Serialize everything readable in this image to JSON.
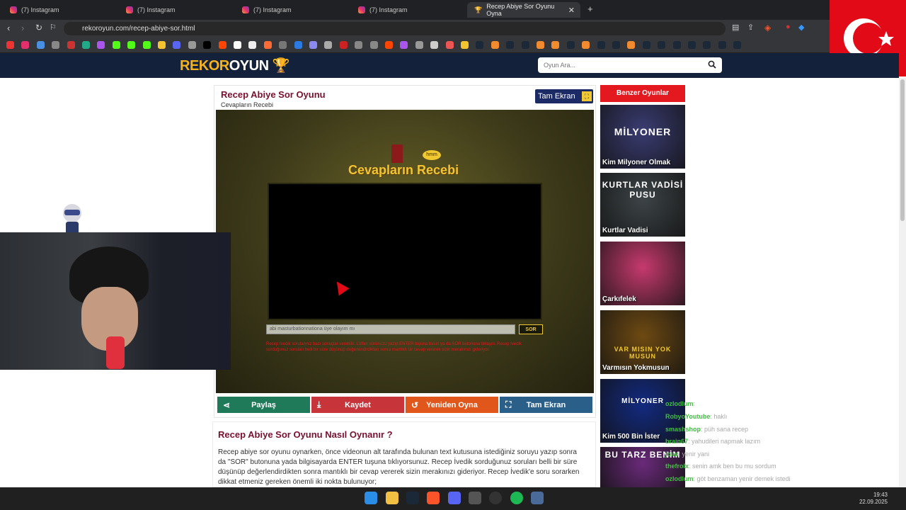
{
  "browser": {
    "tabs": [
      {
        "label": "(7) Instagram"
      },
      {
        "label": "(7) Instagram"
      },
      {
        "label": "(7) Instagram"
      },
      {
        "label": "(7) Instagram"
      },
      {
        "label": "Recep Abiye Sor Oyunu Oyna"
      }
    ],
    "url": "rekoroyun.com/recep-abiye-sor.html"
  },
  "site": {
    "logo_a": "REKOR",
    "logo_b": "OYUN",
    "search_placeholder": "Oyun Ara..."
  },
  "game": {
    "title": "Recep Abiye Sor Oyunu",
    "subtitle": "Cevapların Recebi",
    "fullscreen_label": "Tam Ekran",
    "inner_logo": "Cevapların Recebi",
    "hmm": "hmm",
    "question_value": "abi masturbationnationa üye olayım mı",
    "ask_label": "SOR",
    "warning_text": "Recep İvedik sorularınız bazı sonuçlar verebilir. Lütfen sorunuzu yazıp ENTER tuşuna basın ya da SOR butonuna tıklayın. Recep İvedik sorduğunuz soruları belli bir süre düşünüp değerlendirdikten sonra mantıklı bir cevap vererek sizin merakınızı gideriyor."
  },
  "actions": [
    {
      "label": "Paylaş",
      "color": "#1f7a5a"
    },
    {
      "label": "Kaydet",
      "color": "#c7343a"
    },
    {
      "label": "Yeniden Oyna",
      "color": "#e0561b"
    },
    {
      "label": "Tam Ekran",
      "color": "#2a5f8a"
    }
  ],
  "howto": {
    "title": "Recep Abiye Sor Oyunu Nasıl Oynanır ?",
    "text": "Recep abiye sor oyunu oynarken, önce videonun alt tarafında bulunan text kutusuna istediğiniz soruyu yazıp sonra da \"SOR\" butonuna yada bilgisayarda ENTER tuşuna tıklıyorsunuz. Recep İvedik sorduğunuz soruları belli bir süre düşünüp değerlendirdikten sonra mantıklı bir cevap vererek sizin merakınızı gideriyor. Recep İvedik'e soru sorarken dikkat etmeniz gereken önemli iki nokta bulunuyor;"
  },
  "sidebar": {
    "header": "Benzer Oyunlar",
    "cards": [
      {
        "label": "Kim Milyoner Olmak",
        "art": "MİLYONER",
        "bg": "#3a3c72"
      },
      {
        "label": "Kurtlar Vadisi",
        "art": "KURTLAR VADİSİ PUSU",
        "bg": "#3d4447"
      },
      {
        "label": "Çarkıfelek",
        "art": "",
        "bg": "#c63a6d"
      },
      {
        "label": "Varmısın Yokmusun",
        "art": "VAR MISIN YOK MUSUN",
        "bg": "#6e4a12"
      },
      {
        "label": "Kim 500 Bin İster",
        "art": "MİLYONER",
        "bg": "#132a80"
      },
      {
        "label": "",
        "art": "BU TARZ BENİM",
        "bg": "#6a2a7a"
      }
    ]
  },
  "chat": [
    {
      "user": "ozlodlum",
      "msg": ": "
    },
    {
      "user": "RobyoYoutube",
      "msg": ": haklı"
    },
    {
      "user": "smashshop",
      "msg": ": püh sana recep"
    },
    {
      "user": "brain67",
      "msg": ": yahudileri napmak lazım"
    },
    {
      "user": "joao",
      "msg": ": yenir yani"
    },
    {
      "user": "thefrolx",
      "msg": ": senin amk ben bu mu sordum"
    },
    {
      "user": "ozlodlum",
      "msg": ": göt benzaman yenir demek istedi"
    }
  ],
  "clock": {
    "time": "19:43",
    "date": "22.09.2025"
  }
}
